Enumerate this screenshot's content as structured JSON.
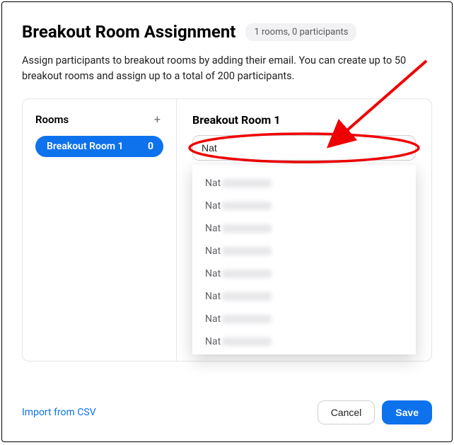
{
  "header": {
    "title": "Breakout Room Assignment",
    "badge": "1 rooms, 0 participants"
  },
  "description": "Assign participants to breakout rooms by adding their email. You can create up to 50 breakout rooms and assign up to a total of 200 participants.",
  "sidebar": {
    "title": "Rooms",
    "add_icon": "+",
    "items": [
      {
        "label": "Breakout Room 1",
        "count": "0"
      }
    ]
  },
  "main": {
    "heading": "Breakout Room 1",
    "input_value": "Nat",
    "suggestions": [
      {
        "prefix": "Nat"
      },
      {
        "prefix": "Nat"
      },
      {
        "prefix": "Nat"
      },
      {
        "prefix": "Nat"
      },
      {
        "prefix": "Nat"
      },
      {
        "prefix": "Nat"
      },
      {
        "prefix": "Nat"
      },
      {
        "prefix": "Nat"
      }
    ]
  },
  "footer": {
    "import_label": "Import from CSV",
    "cancel_label": "Cancel",
    "save_label": "Save"
  }
}
